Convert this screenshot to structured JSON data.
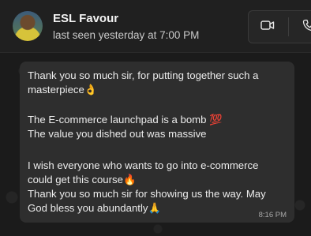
{
  "header": {
    "contact_name": "ESL Favour",
    "status": "last seen yesterday at 7:00 PM",
    "video_call_icon": "video-camera-icon",
    "voice_call_icon": "phone-icon"
  },
  "message": {
    "lines": [
      "Thank you so much sir, for putting together such a",
      "masterpiece👌",
      "",
      "The E-commerce launchpad is a bomb 💯",
      "The value you dished out was massive",
      "",
      "I wish everyone who wants to go into e-commerce",
      "could get this course🔥",
      "Thank you so much sir for showing us the way. May",
      "God bless you abundantly🙏"
    ],
    "time": "8:16 PM"
  },
  "colors": {
    "header_bg": "#202020",
    "chat_bg": "#1b1b1b",
    "bubble_bg": "#2e2e2e",
    "text": "#ececec"
  }
}
